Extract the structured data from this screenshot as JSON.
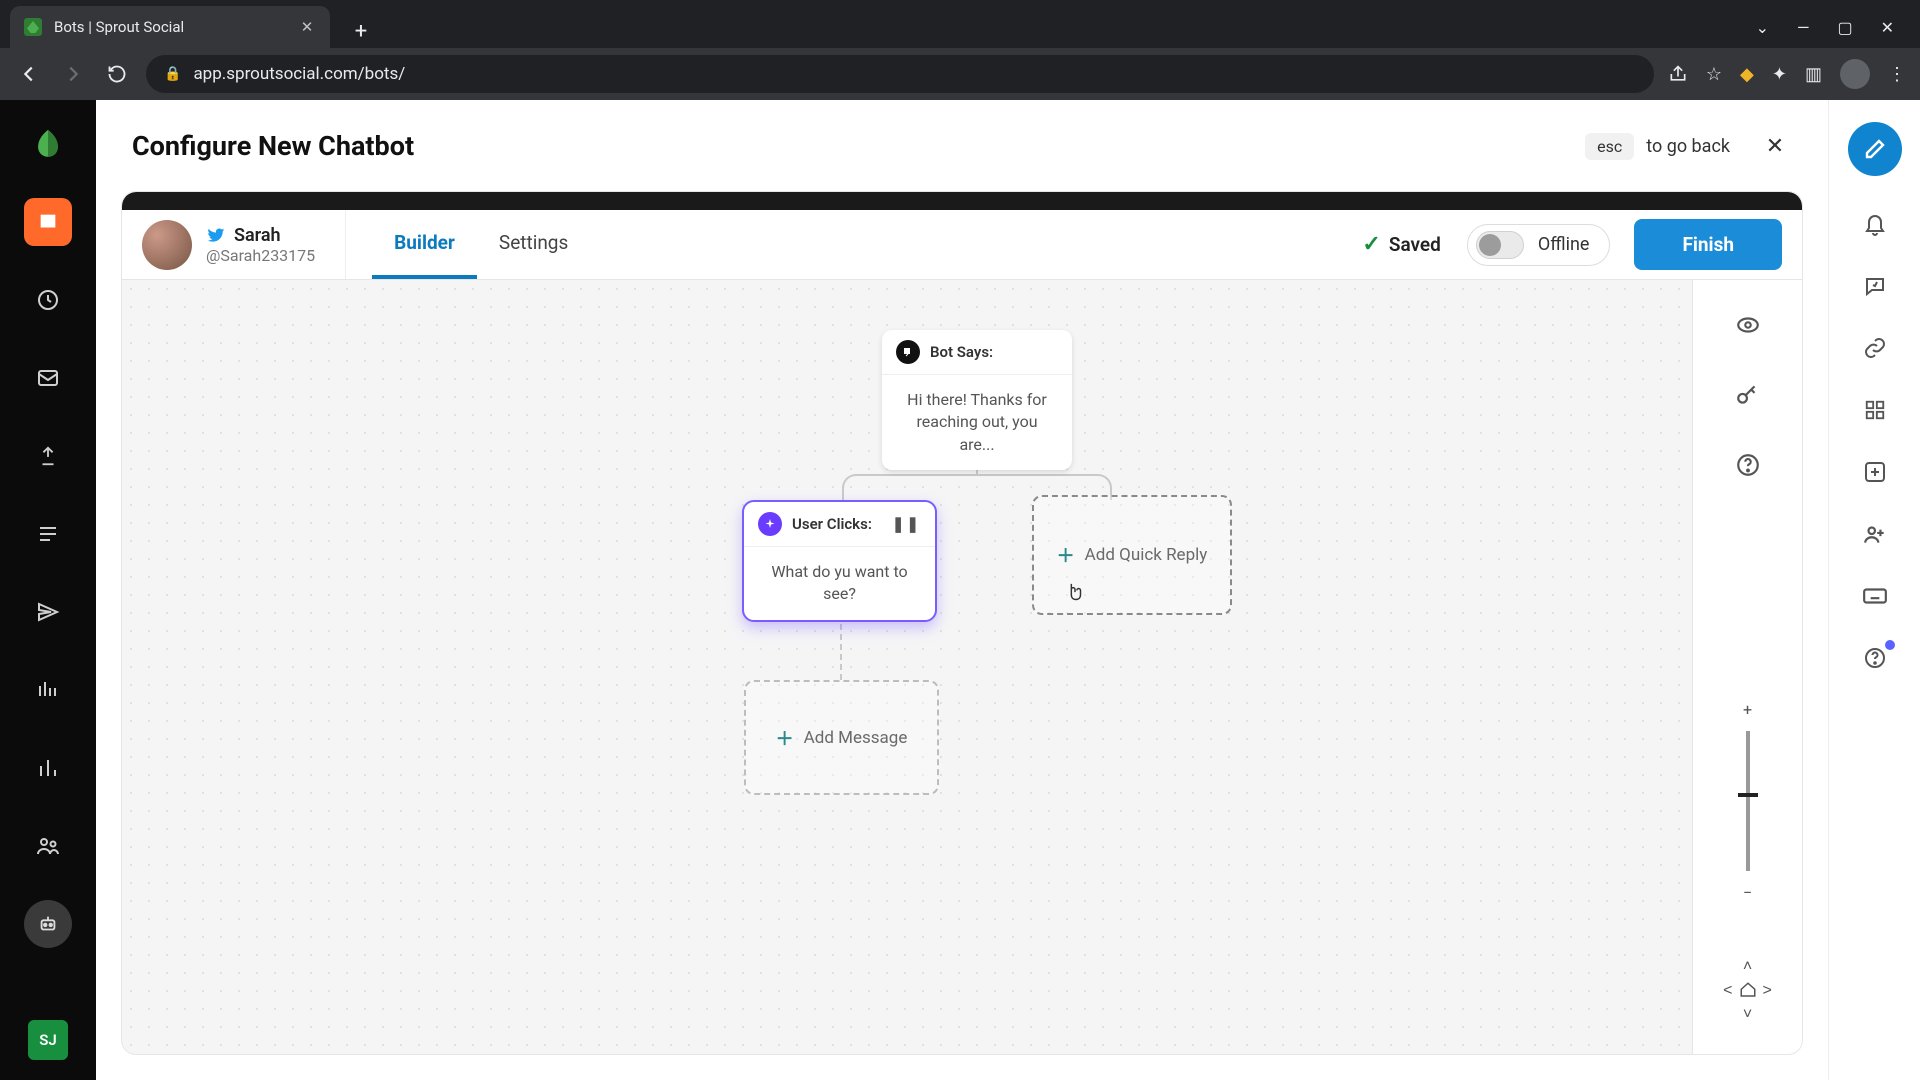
{
  "browser": {
    "tab_title": "Bots | Sprout Social",
    "url": "app.sproutsocial.com/bots/"
  },
  "page": {
    "title": "Configure New Chatbot",
    "esc_label": "esc",
    "go_back_label": "to go back"
  },
  "profile": {
    "name": "Sarah",
    "handle": "@Sarah233175"
  },
  "tabs": {
    "builder": "Builder",
    "settings": "Settings"
  },
  "status": {
    "saved": "Saved",
    "offline": "Offline"
  },
  "buttons": {
    "finish": "Finish"
  },
  "flow": {
    "bot_says_label": "Bot Says:",
    "bot_says_text": "Hi there! Thanks for reaching out, you are...",
    "user_clicks_label": "User Clicks:",
    "user_clicks_text": "What do yu want to see?",
    "add_quick_reply": "Add Quick Reply",
    "add_message": "Add Message"
  },
  "rail_avatar": "SJ"
}
